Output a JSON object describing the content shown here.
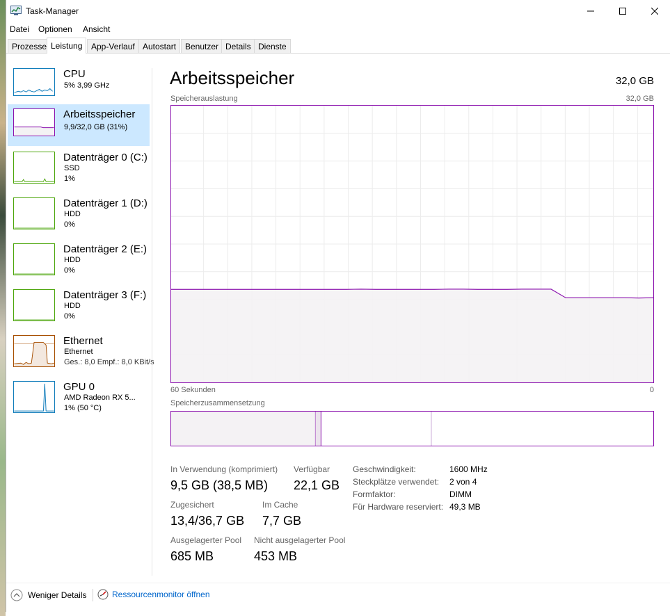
{
  "window": {
    "title": "Task-Manager"
  },
  "menu": [
    "Datei",
    "Optionen",
    "Ansicht"
  ],
  "tabs": [
    "Prozesse",
    "Leistung",
    "App-Verlauf",
    "Autostart",
    "Benutzer",
    "Details",
    "Dienste"
  ],
  "active_tab": "Leistung",
  "sidebar": {
    "items": [
      {
        "title": "CPU",
        "line1": "5% 3,99 GHz",
        "line2": "",
        "color": "#117dbb"
      },
      {
        "title": "Arbeitsspeicher",
        "line1": "9,9/32,0 GB (31%)",
        "line2": "",
        "color": "#8b12ae"
      },
      {
        "title": "Datenträger 0 (C:)",
        "line1": "SSD",
        "line2": "1%",
        "color": "#4da60c"
      },
      {
        "title": "Datenträger 1 (D:)",
        "line1": "HDD",
        "line2": "0%",
        "color": "#4da60c"
      },
      {
        "title": "Datenträger 2 (E:)",
        "line1": "HDD",
        "line2": "0%",
        "color": "#4da60c"
      },
      {
        "title": "Datenträger 3 (F:)",
        "line1": "HDD",
        "line2": "0%",
        "color": "#4da60c"
      },
      {
        "title": "Ethernet",
        "line1": "Ethernet",
        "line2": "Ges.: 8,0 Empf.: 8,0 KBit/s",
        "color": "#a74f01"
      },
      {
        "title": "GPU 0",
        "line1": "AMD Radeon RX 5...",
        "line2": "1% (50 °C)",
        "color": "#117dbb"
      }
    ]
  },
  "main": {
    "title": "Arbeitsspeicher",
    "total": "32,0 GB",
    "graph_label": "Speicherauslastung",
    "graph_max": "32,0 GB",
    "time_label": "60 Sekunden",
    "time_end": "0",
    "composition_label": "Speicherzusammensetzung",
    "stats": {
      "in_use_label": "In Verwendung (komprimiert)",
      "in_use_value": "9,5 GB (38,5 MB)",
      "available_label": "Verfügbar",
      "available_value": "22,1 GB",
      "committed_label": "Zugesichert",
      "committed_value": "13,4/36,7 GB",
      "cached_label": "Im Cache",
      "cached_value": "7,7 GB",
      "paged_label": "Ausgelagerter Pool",
      "paged_value": "685 MB",
      "nonpaged_label": "Nicht ausgelagerter Pool",
      "nonpaged_value": "453 MB"
    },
    "details": [
      {
        "label": "Geschwindigkeit:",
        "value": "1600 MHz"
      },
      {
        "label": "Steckplätze verwendet:",
        "value": "2 von 4"
      },
      {
        "label": "Formfaktor:",
        "value": "DIMM"
      },
      {
        "label": "Für Hardware reserviert:",
        "value": "49,3 MB"
      }
    ],
    "usage_percent_history": [
      33.6,
      33.6,
      33.6,
      33.6,
      33.6,
      33.6,
      33.6,
      33.6,
      33.6,
      33.6,
      33.6,
      33.6,
      33.6,
      33.7,
      33.6,
      33.6,
      33.6,
      33.6,
      33.6,
      33.7,
      33.7,
      33.6,
      33.6,
      33.6,
      33.7,
      33.7,
      33.7,
      30.6,
      30.6,
      30.6,
      30.6,
      30.6,
      30.5,
      30.6
    ]
  },
  "footer": {
    "less_details": "Weniger Details",
    "resource_monitor": "Ressourcenmonitor öffnen"
  }
}
